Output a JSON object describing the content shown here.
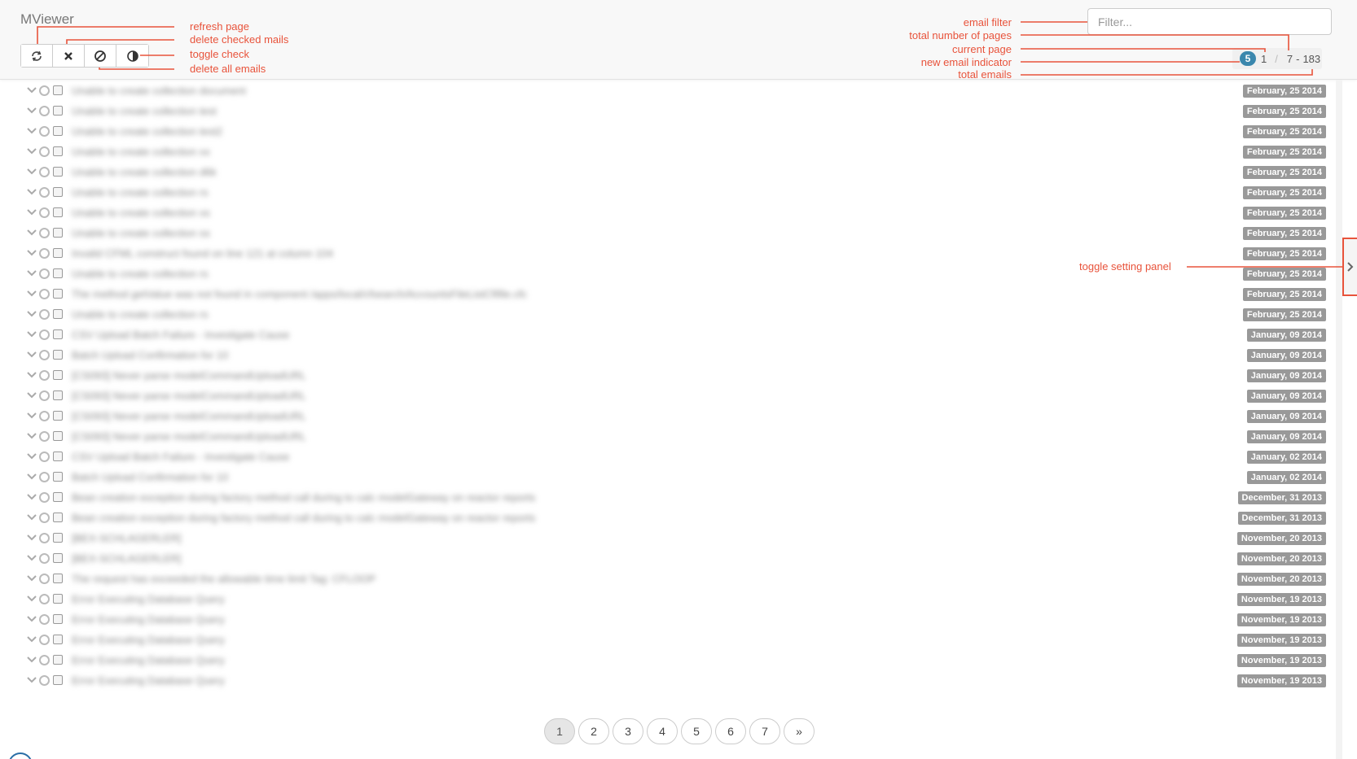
{
  "app": {
    "title": "MViewer"
  },
  "filter": {
    "placeholder": "Filter..."
  },
  "pager": {
    "new_count": "5",
    "current_page": "1",
    "slash": "/",
    "total_pages": "7",
    "dash": "-",
    "total_emails": "183"
  },
  "annotations": {
    "refresh_page": "refresh page",
    "delete_checked": "delete checked mails",
    "toggle_check": "toggle check",
    "delete_all": "delete all emails",
    "email_filter": "email filter",
    "total_pages": "total number of pages",
    "current_page": "current page",
    "new_email": "new email indicator",
    "total_emails": "total emails",
    "toggle_settings": "toggle setting panel"
  },
  "colors": {
    "annotation": "#e8533b",
    "badge_new": "#3a87ad",
    "date_badge": "#999999"
  },
  "icons": [
    "refresh-icon",
    "delete-icon",
    "ban-icon",
    "half-circle-icon",
    "chevron-down-icon",
    "chevron-right-icon"
  ],
  "mails": [
    {
      "subject": "Unable to create collection document",
      "date": "February, 25 2014"
    },
    {
      "subject": "Unable to create collection test",
      "date": "February, 25 2014"
    },
    {
      "subject": "Unable to create collection test2",
      "date": "February, 25 2014"
    },
    {
      "subject": "Unable to create collection xx",
      "date": "February, 25 2014"
    },
    {
      "subject": "Unable to create collection d6k",
      "date": "February, 25 2014"
    },
    {
      "subject": "Unable to create collection rs",
      "date": "February, 25 2014"
    },
    {
      "subject": "Unable to create collection xs",
      "date": "February, 25 2014"
    },
    {
      "subject": "Unable to create collection ss",
      "date": "February, 25 2014"
    },
    {
      "subject": "Invalid CFML construct found on line 121 at column 104",
      "date": "February, 25 2014"
    },
    {
      "subject": "Unable to create collection rs",
      "date": "February, 25 2014"
    },
    {
      "subject": "The method getValue was not found in component /apps/local/cfsearch/AccountsFileListCfifile.cfc",
      "date": "February, 25 2014"
    },
    {
      "subject": "Unable to create collection rs",
      "date": "February, 25 2014"
    },
    {
      "subject": "CSV Upload Batch Failure - Investigate Cause",
      "date": "January, 09 2014"
    },
    {
      "subject": "Batch Upload Confirmation for 10",
      "date": "January, 09 2014"
    },
    {
      "subject": "[CS093] Never parse modelCommandUploadURL",
      "date": "January, 09 2014"
    },
    {
      "subject": "[CS093] Never parse modelCommandUploadURL",
      "date": "January, 09 2014"
    },
    {
      "subject": "[CS093] Never parse modelCommandUploadURL",
      "date": "January, 09 2014"
    },
    {
      "subject": "[CS093] Never parse modelCommandUploadURL",
      "date": "January, 09 2014"
    },
    {
      "subject": "CSV Upload Batch Failure - Investigate Cause",
      "date": "January, 02 2014"
    },
    {
      "subject": "Batch Upload Confirmation for 10",
      "date": "January, 02 2014"
    },
    {
      "subject": "Bean creation exception during factory method call during to calc modelGateway on reactor reports",
      "date": "December, 31 2013"
    },
    {
      "subject": "Bean creation exception during factory method call during to calc modelGateway on reactor reports",
      "date": "December, 31 2013"
    },
    {
      "subject": "[BEX-SCHLAGERLER]",
      "date": "November, 20 2013"
    },
    {
      "subject": "[BEX-SCHLAGERLER]",
      "date": "November, 20 2013"
    },
    {
      "subject": "The request has exceeded the allowable time limit Tag: CFLOOP",
      "date": "November, 20 2013"
    },
    {
      "subject": "Error Executing Database Query",
      "date": "November, 19 2013"
    },
    {
      "subject": "Error Executing Database Query",
      "date": "November, 19 2013"
    },
    {
      "subject": "Error Executing Database Query",
      "date": "November, 19 2013"
    },
    {
      "subject": "Error Executing Database Query",
      "date": "November, 19 2013"
    },
    {
      "subject": "Error Executing Database Query",
      "date": "November, 19 2013"
    }
  ],
  "pagination": [
    "1",
    "2",
    "3",
    "4",
    "5",
    "6",
    "7",
    "»"
  ]
}
